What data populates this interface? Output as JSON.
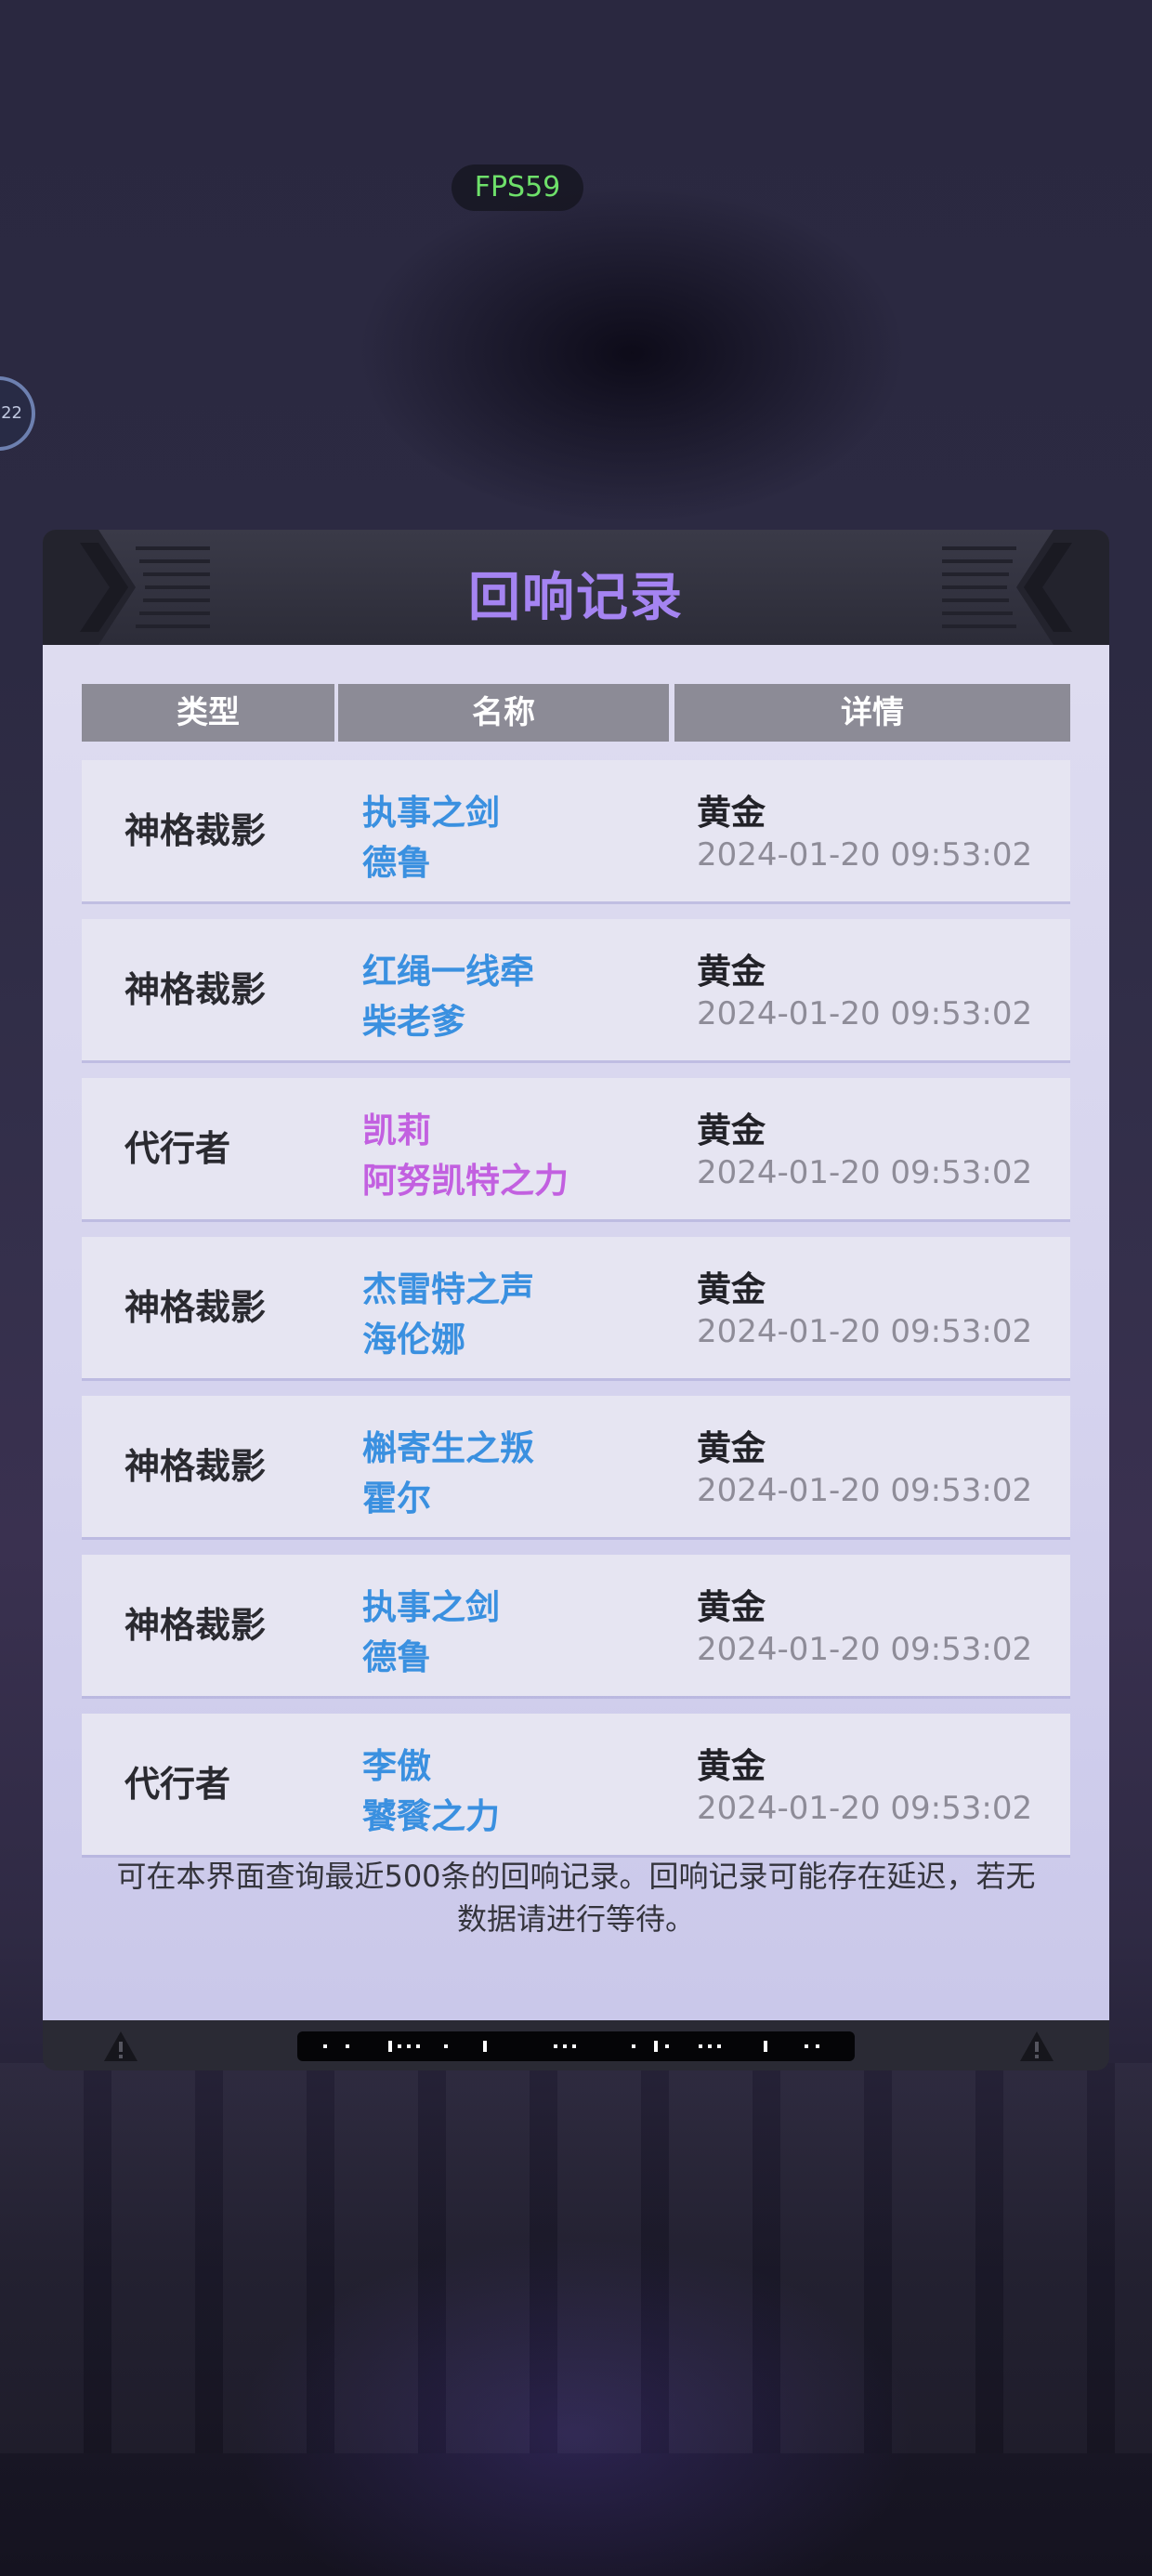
{
  "status": {
    "fps": "FPS59",
    "float_button_text": "22"
  },
  "dialog": {
    "title": "回响记录",
    "columns": [
      "类型",
      "名称",
      "详情"
    ],
    "rows": [
      {
        "type": "神格裁影",
        "name1": "执事之剑",
        "name2": "德鲁",
        "detail": "黄金",
        "time": "2024-01-20 09:53:02",
        "name_color": "blue"
      },
      {
        "type": "神格裁影",
        "name1": "红绳一线牵",
        "name2": "柴老爹",
        "detail": "黄金",
        "time": "2024-01-20 09:53:02",
        "name_color": "blue"
      },
      {
        "type": "代行者",
        "name1": "凯莉",
        "name2": "阿努凯特之力",
        "detail": "黄金",
        "time": "2024-01-20 09:53:02",
        "name_color": "purple"
      },
      {
        "type": "神格裁影",
        "name1": "杰雷特之声",
        "name2": "海伦娜",
        "detail": "黄金",
        "time": "2024-01-20 09:53:02",
        "name_color": "blue"
      },
      {
        "type": "神格裁影",
        "name1": "槲寄生之叛",
        "name2": "霍尔",
        "detail": "黄金",
        "time": "2024-01-20 09:53:02",
        "name_color": "blue"
      },
      {
        "type": "神格裁影",
        "name1": "执事之剑",
        "name2": "德鲁",
        "detail": "黄金",
        "time": "2024-01-20 09:53:02",
        "name_color": "blue"
      },
      {
        "type": "代行者",
        "name1": "李傲",
        "name2": "饕餮之力",
        "detail": "黄金",
        "time": "2024-01-20 09:53:02",
        "name_color": "blue"
      }
    ],
    "note": "可在本界面查询最近500条的回响记录。回响记录可能存在延迟，若无数据请进行等待。"
  },
  "colors": {
    "title": "#a584f2",
    "name_blue": "#3a90e0",
    "name_purple": "#c260e0",
    "fps_green": "#6ee06a"
  },
  "icons": [
    "warning-icon",
    "chevron-decoration-icon"
  ]
}
